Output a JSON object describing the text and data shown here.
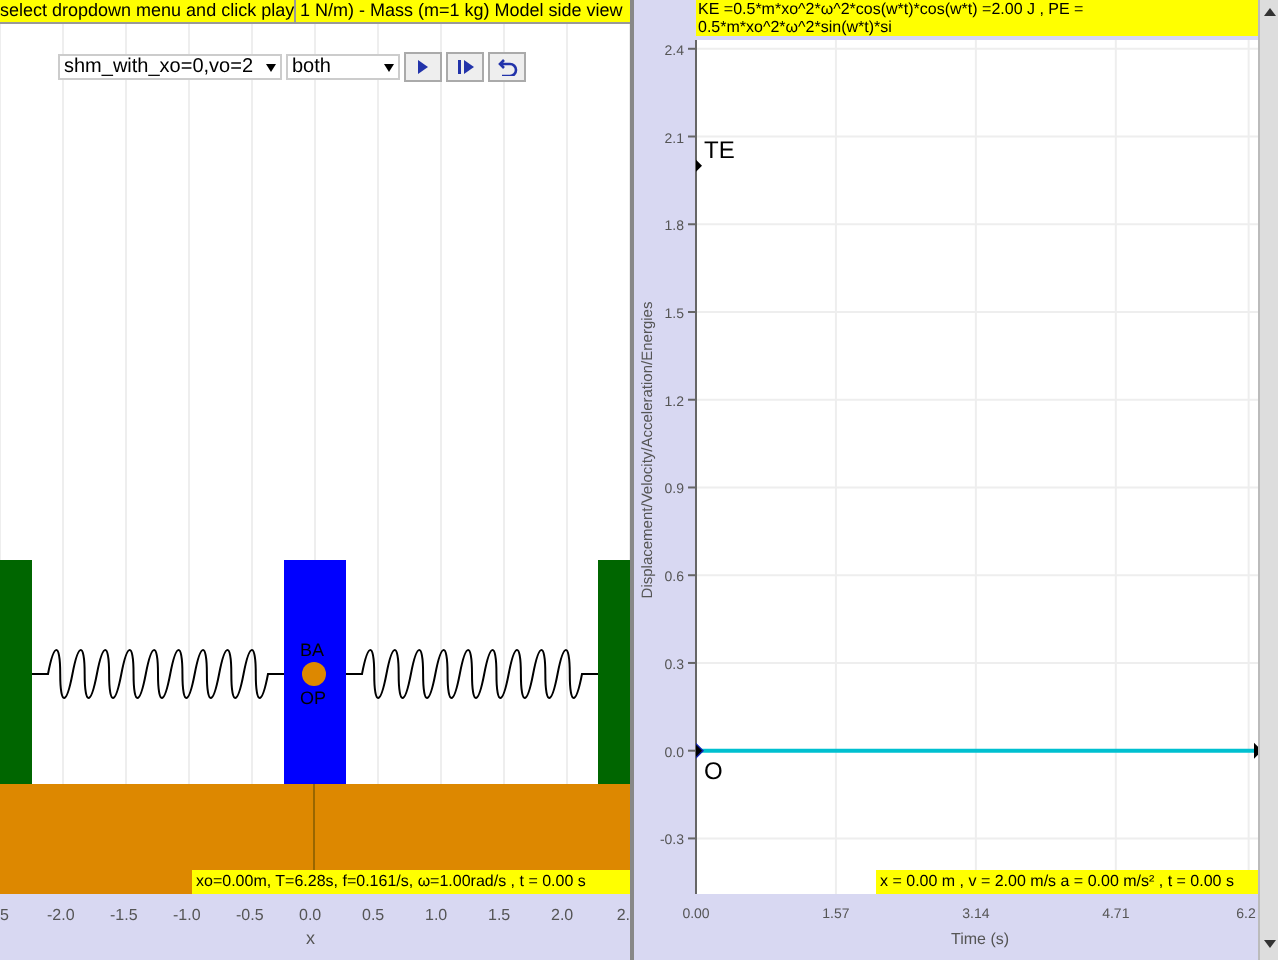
{
  "left_panel": {
    "header": [
      "select dropdown menu and click play",
      "1 N/m) - Mass (m=1 kg) Model side view"
    ],
    "scenario_select": {
      "value": "shm_with_xo=0,vo=2"
    },
    "display_select": {
      "value": "both"
    },
    "mass_labels": [
      "BA",
      "OP"
    ],
    "status": "xo=0.00m, T=6.28s, f=0.161/s, ω=1.00rad/s , t = 0.00 s",
    "x_axis": {
      "label": "x",
      "ticks": [
        "5",
        "-2.0",
        "-1.5",
        "-1.0",
        "-0.5",
        "0.0",
        "0.5",
        "1.0",
        "1.5",
        "2.0",
        "2."
      ]
    }
  },
  "right_panel": {
    "header": "KE =0.5*m*xo^2*ω^2*cos(w*t)*cos(w*t) =2.00 J , PE = 0.5*m*xo^2*ω^2*sin(w*t)*si",
    "status": "x = 0.00 m , v = 2.00 m/s a = 0.00 m/s² , t = 0.00 s",
    "chart_data": {
      "type": "line",
      "xlabel": "Time (s)",
      "ylabel": "Displacement/Velocity/Acceleration/Energies",
      "x": [
        0,
        6.28
      ],
      "grid": true,
      "series": [
        {
          "color": "#00c0d0",
          "marker": "triangle",
          "values": [
            0,
            0
          ]
        }
      ],
      "xlim": [
        0,
        6.35
      ],
      "ylim": [
        -0.49,
        2.43
      ],
      "xticks": [
        {
          "value": 0,
          "label": "0.00"
        },
        {
          "value": 1.57,
          "label": "1.57"
        },
        {
          "value": 3.14,
          "label": "3.14"
        },
        {
          "value": 4.71,
          "label": "4.71"
        },
        {
          "value": 6.2,
          "label": "6.2"
        }
      ],
      "yticks": [
        {
          "value": 2.4,
          "label": "2.4"
        },
        {
          "value": 2.1,
          "label": "2.1"
        },
        {
          "value": 1.8,
          "label": "1.8"
        },
        {
          "value": 1.5,
          "label": "1.5"
        },
        {
          "value": 1.2,
          "label": "1.2"
        },
        {
          "value": 0.9,
          "label": "0.9"
        },
        {
          "value": 0.6,
          "label": "0.6"
        },
        {
          "value": 0.3,
          "label": "0.3"
        },
        {
          "value": 0,
          "label": "0.0"
        },
        {
          "value": -0.3,
          "label": "-0.3"
        }
      ],
      "annotations": [
        {
          "text": "TE",
          "x": 0,
          "y": 2
        },
        {
          "text": "O",
          "x": 0,
          "y": 0
        }
      ]
    }
  }
}
